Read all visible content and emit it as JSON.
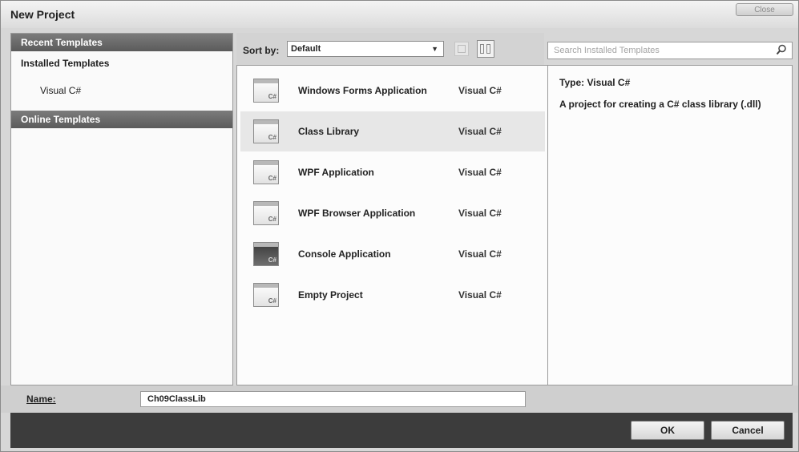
{
  "window": {
    "title": "New Project",
    "close_label": "Close"
  },
  "sidebar": {
    "recent_templates": "Recent Templates",
    "installed_templates": "Installed Templates",
    "visual_csharp": "Visual C#",
    "online_templates": "Online Templates"
  },
  "toolbar": {
    "sort_label": "Sort by:",
    "sort_value": "Default"
  },
  "search": {
    "placeholder": "Search Installed Templates"
  },
  "templates": [
    {
      "name": "Windows Forms Application",
      "lang": "Visual C#"
    },
    {
      "name": "Class Library",
      "lang": "Visual C#"
    },
    {
      "name": "WPF Application",
      "lang": "Visual C#"
    },
    {
      "name": "WPF Browser Application",
      "lang": "Visual C#"
    },
    {
      "name": "Console Application",
      "lang": "Visual C#"
    },
    {
      "name": "Empty Project",
      "lang": "Visual C#"
    }
  ],
  "selected_template": "Class Library",
  "details": {
    "type_line": "Type:  Visual C#",
    "description": "A project for creating a C# class library (.dll)"
  },
  "name_field": {
    "label": "Name:",
    "value": "Ch09ClassLib"
  },
  "buttons": {
    "ok": "OK",
    "cancel": "Cancel"
  },
  "colors": {
    "header_bg": "#5b5b5b",
    "bottom_bar": "#3c3c3c",
    "selected_row": "#e7e7e7"
  }
}
